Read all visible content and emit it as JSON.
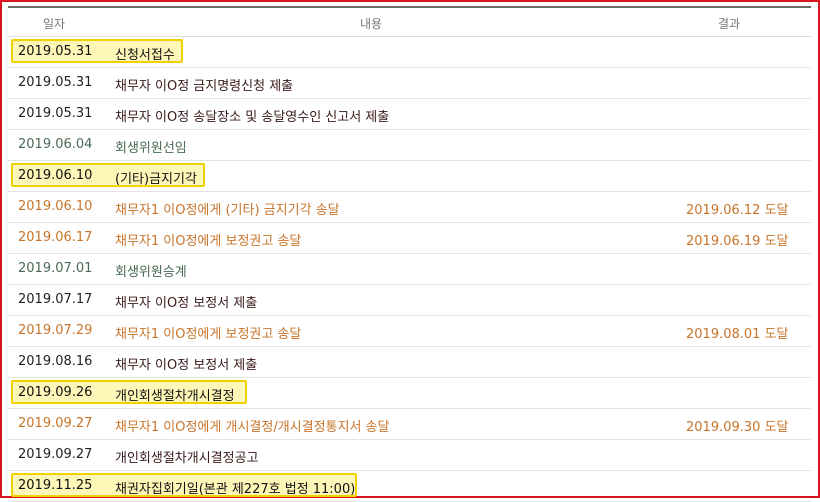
{
  "table": {
    "headers": {
      "date": "일자",
      "content": "내용",
      "result": "결과"
    },
    "rows": [
      {
        "date": "2019.05.31",
        "content": "신청서접수",
        "result": "",
        "color": "black",
        "highlight": true,
        "hl_w": 172
      },
      {
        "date": "2019.05.31",
        "content": "채무자 이O정 금지명령신청 제출",
        "result": "",
        "color": "black",
        "highlight": false
      },
      {
        "date": "2019.05.31",
        "content": "채무자 이O정 송달장소 및 송달영수인 신고서 제출",
        "result": "",
        "color": "black",
        "highlight": false
      },
      {
        "date": "2019.06.04",
        "content": "회생위원선임",
        "result": "",
        "color": "green",
        "highlight": false
      },
      {
        "date": "2019.06.10",
        "content": "(기타)금지기각",
        "result": "",
        "color": "black",
        "highlight": true,
        "hl_w": 194
      },
      {
        "date": "2019.06.10",
        "content": "채무자1 이O정에게 (기타) 금지기각 송달",
        "result": "2019.06.12 도달",
        "color": "orange",
        "highlight": false
      },
      {
        "date": "2019.06.17",
        "content": "채무자1 이O정에게 보정권고 송달",
        "result": "2019.06.19 도달",
        "color": "orange",
        "highlight": false
      },
      {
        "date": "2019.07.01",
        "content": "회생위원승계",
        "result": "",
        "color": "green",
        "highlight": false
      },
      {
        "date": "2019.07.17",
        "content": "채무자 이O정 보정서 제출",
        "result": "",
        "color": "black",
        "highlight": false
      },
      {
        "date": "2019.07.29",
        "content": "채무자1 이O정에게 보정권고 송달",
        "result": "2019.08.01 도달",
        "color": "orange",
        "highlight": false
      },
      {
        "date": "2019.08.16",
        "content": "채무자 이O정 보정서 제출",
        "result": "",
        "color": "black",
        "highlight": false
      },
      {
        "date": "2019.09.26",
        "content": "개인회생절차개시결정",
        "result": "",
        "color": "black",
        "highlight": true,
        "hl_w": 236
      },
      {
        "date": "2019.09.27",
        "content": "채무자1 이O정에게 개시결정/개시결정통지서 송달",
        "result": "2019.09.30 도달",
        "color": "orange",
        "highlight": false
      },
      {
        "date": "2019.09.27",
        "content": "개인회생절차개시결정공고",
        "result": "",
        "color": "black",
        "highlight": false
      },
      {
        "date": "2019.11.25",
        "content": "채권자집회기일(본관 제227호 법정 11:00)",
        "result": "",
        "color": "black",
        "highlight": true,
        "hl_w": 346
      }
    ]
  },
  "colors": {
    "frame": "#d9141e",
    "highlight_fill": "#fff7b8",
    "highlight_border": "#f2d100",
    "orange_text": "#c8742a",
    "green_text": "#4a6a54"
  }
}
